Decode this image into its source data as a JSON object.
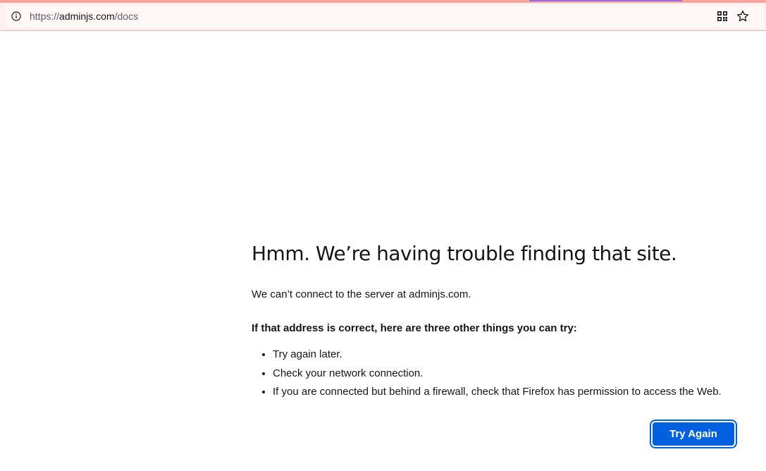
{
  "browser": {
    "url": {
      "scheme": "https://",
      "host": "adminjs.com",
      "path": "/docs"
    },
    "icons": {
      "site_info": "info-icon",
      "qr_code": "qr-code-icon",
      "bookmark": "star-icon"
    },
    "colors": {
      "top_strip": "#f6a59f",
      "toolbar_bg": "#fdf0ee",
      "tab_indicator": "#9d6be0"
    }
  },
  "error_page": {
    "title": "Hmm. We’re having trouble finding that site.",
    "message": "We can’t connect to the server at adminjs.com.",
    "advice_title": "If that address is correct, here are three other things you can try:",
    "advice_items": [
      "Try again later.",
      "Check your network connection.",
      "If you are connected but behind a firewall, check that Firefox has permission to access the Web."
    ],
    "try_again_label": "Try Again",
    "colors": {
      "button_bg": "#0060df",
      "button_text": "#ffffff"
    }
  }
}
